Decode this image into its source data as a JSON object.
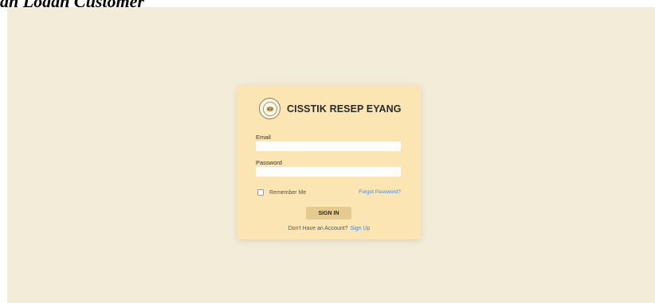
{
  "document": {
    "caption": "an Logan Customer"
  },
  "login": {
    "brand_name": "CISSTIK RESEP EYANG",
    "logo_icon": "restaurant-logo-emblem",
    "email_label": "Email",
    "email_value": "",
    "password_label": "Password",
    "password_value": "",
    "remember_label": "Remember Me",
    "forgot_label": "Forgot Password?",
    "signin_label": "SIGN IN",
    "signup_prompt": "Don't Have an Account?",
    "signup_label": "Sign Up"
  },
  "colors": {
    "page_background": "#f3ecd8",
    "card_background": "#fae5b3",
    "button_background": "#e4ca8f",
    "link": "#4a86d6"
  }
}
